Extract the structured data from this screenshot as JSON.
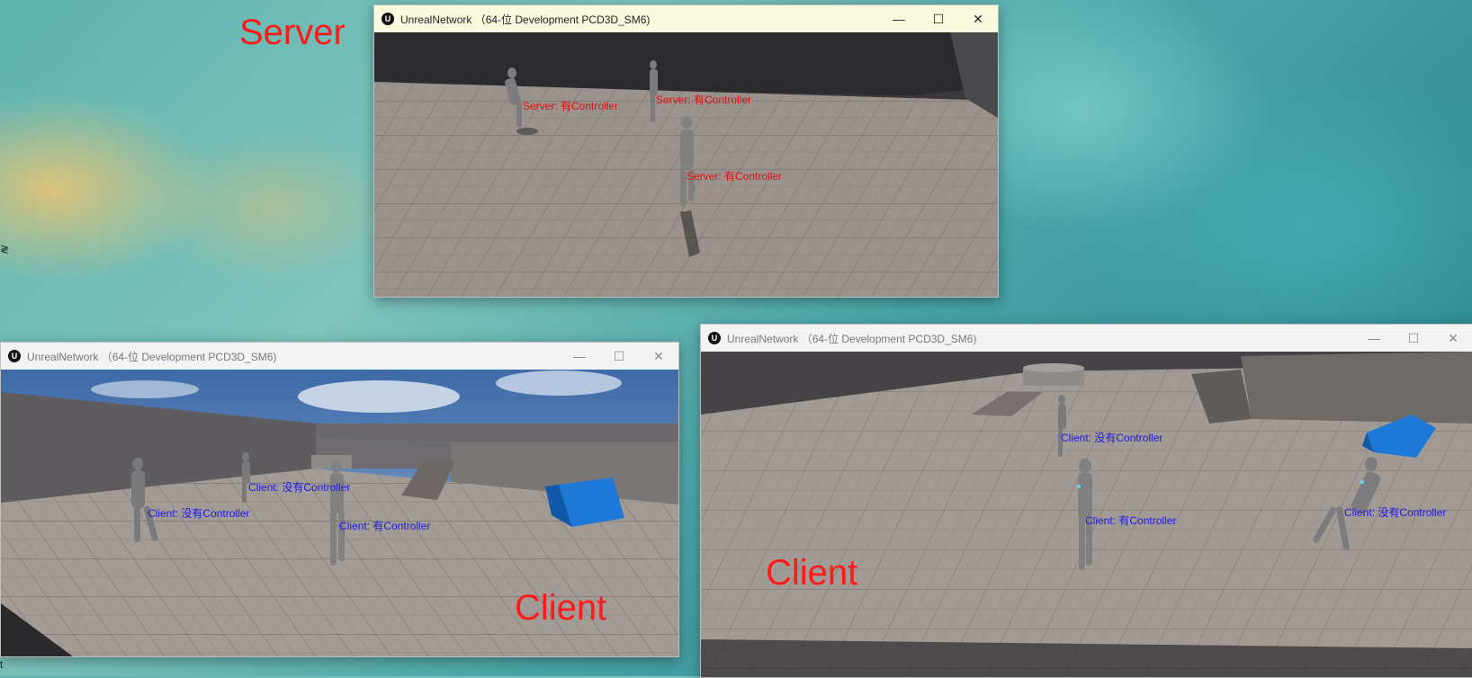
{
  "overlay_labels": {
    "server": "Server",
    "client_left": "Client",
    "client_right": "Client"
  },
  "windows": {
    "server": {
      "title": "UnrealNetwork  （64-位 Development PCD3D_SM6)",
      "labels": [
        "Server: 有Controller",
        "Server: 有Controller",
        "Server: 有Controller"
      ]
    },
    "client_left": {
      "title": "UnrealNetwork  （64-位 Development PCD3D_SM6)",
      "labels": [
        "Client: 没有Controller",
        "Client: 没有Controller",
        "Client: 有Controller"
      ]
    },
    "client_right": {
      "title": "UnrealNetwork  （64-位 Development PCD3D_SM6)",
      "labels": [
        "Client: 没有Controller",
        "Client: 有Controller",
        "Client: 没有Controller"
      ]
    }
  },
  "window_controls": {
    "minimize": "—",
    "maximize": "☐",
    "close": "✕"
  },
  "app_icon": "U",
  "colors": {
    "server_label": "#e01010",
    "client_label": "#1a1ae6",
    "overlay_text": "#ff1a1a"
  }
}
